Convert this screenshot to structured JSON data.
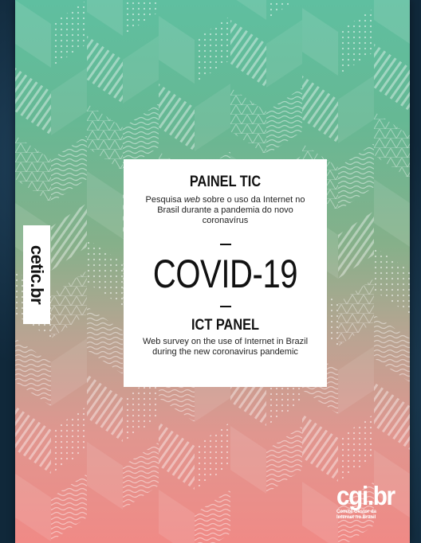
{
  "cover": {
    "side_label": "cetic.br",
    "painel_title": "PAINEL TIC",
    "painel_sub_before": "Pesquisa ",
    "painel_sub_em": "web",
    "painel_sub_after": " sobre o uso da Internet no Brasil durante a pandemia do novo coronavírus",
    "headline": "COVID-19",
    "ict_title": "ICT PANEL",
    "ict_sub": "Web survey on the use of Internet in Brazil during the new coronavirus pandemic",
    "logo_mark": "cgi.br",
    "logo_line1": "Comitê Gestor da",
    "logo_line2": "Internet no Brasil"
  },
  "colors": {
    "backdrop": "#10283a",
    "gradient_top": "#5fbfa0",
    "gradient_bottom": "#f08a86",
    "card": "#ffffff",
    "text": "#111111"
  }
}
